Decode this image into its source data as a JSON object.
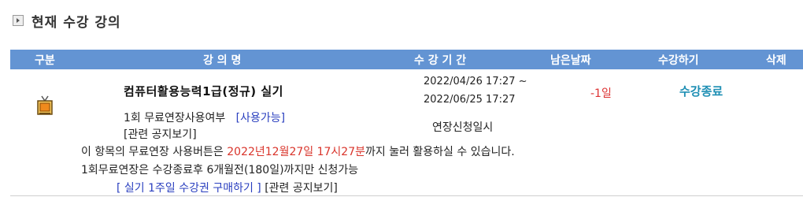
{
  "section": {
    "title": "현재 수강 강의",
    "icon": "square-arrow-icon"
  },
  "table": {
    "headers": {
      "category": "구분",
      "course_name": "강 의 명",
      "period": "수 강 기 간",
      "remaining": "남은날짜",
      "action": "수강하기",
      "delete": "삭제"
    },
    "row": {
      "icon": "tv-icon",
      "course_name": "컴퓨터활용능력1급(정규) 실기",
      "period_start": "2022/04/26 17:27 ~",
      "period_end": "2022/06/25 17:27",
      "remaining": "-1일",
      "status": "수강종료",
      "free_extension_label": "1회 무료연장사용여부",
      "free_extension_status": "[사용가능]",
      "related_notice": "[관련 공지보기]",
      "extension_request": "연장신청일시",
      "info_prefix": "이 항목의 무료연장 사용버튼은 ",
      "info_deadline": "2022년12월27일 17시27분",
      "info_suffix": "까지 눌러 활용하실 수 있습니다.",
      "rule_text": "1회무료연장은 수강종료후 6개월전(180일)까지만 신청가능",
      "purchase_link": "[ 실기 1주일 수강권 구매하기 ]",
      "related_notice_2": "[관련 공지보기]"
    }
  },
  "colors": {
    "header_bg": "#6394d3",
    "remaining": "#dd3333",
    "status": "#1f8fb4",
    "link_blue": "#2a3fbf",
    "deadline_red": "#d9342b"
  }
}
